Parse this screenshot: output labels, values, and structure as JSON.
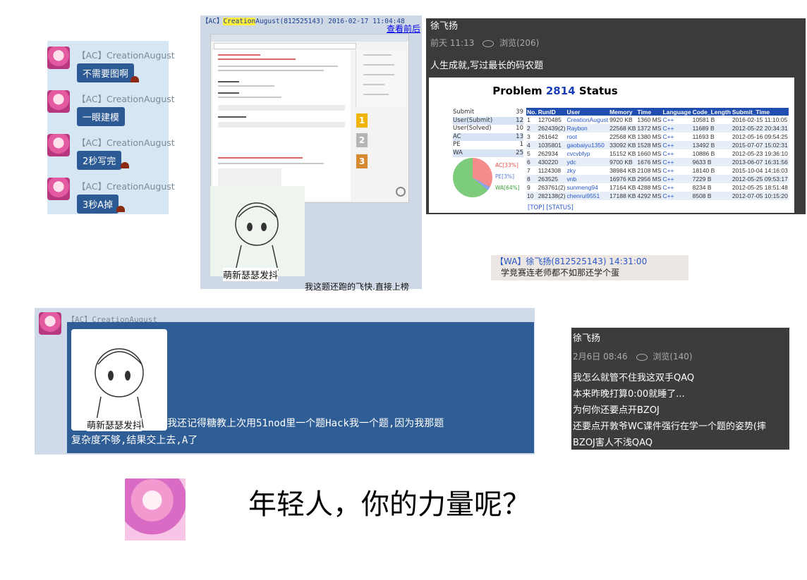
{
  "chatA": {
    "items": [
      {
        "name": "【AC】CreationAugust",
        "text": "不需要图啊"
      },
      {
        "name": "【AC】CreationAugust",
        "text": "一眼建模"
      },
      {
        "name": "【AC】CreationAugust",
        "text": "2秒写完"
      },
      {
        "name": "【AC】CreationAugust",
        "text": "3秒A掉"
      }
    ]
  },
  "shotB": {
    "header_tag": "【AC】",
    "header_name_highlight": "Creation",
    "header_rest": "August(812525143)  2016-02-17 11:04:48",
    "link": "查看前后",
    "rank1": "1",
    "rank2": "2",
    "rank3": "3",
    "sticker_caption": "萌新瑟瑟发抖",
    "caption": "我这题还跑的飞快.直接上榜"
  },
  "panelC": {
    "user": "徐飞扬",
    "time": "前天 11:13",
    "views": "浏览(206)",
    "quote": "人生成就,写过最长的码农题",
    "status_title_pre": "Problem",
    "status_title_num": "2814",
    "status_title_post": "Status",
    "stats": [
      {
        "label": "Submit",
        "value": "39"
      },
      {
        "label": "User(Submit)",
        "value": "12"
      },
      {
        "label": "User(Solved)",
        "value": "10"
      },
      {
        "label": "AC",
        "value": "13"
      },
      {
        "label": "PE",
        "value": "1"
      },
      {
        "label": "WA",
        "value": "25"
      }
    ],
    "pie_legend": [
      "AC[33%]",
      "PE[3%]",
      "WA[64%]"
    ],
    "pie_fractions": [
      0.33,
      0.03,
      0.64
    ],
    "columns": [
      "No.",
      "RunID",
      "User",
      "Memory",
      "Time",
      "Language",
      "Code_Length",
      "Submit_Time"
    ],
    "rows": [
      [
        "1",
        "1270485",
        "CreationAugust",
        "9920 KB",
        "1360 MS",
        "C++",
        "10581 B",
        "2016-02-15 11:10:05"
      ],
      [
        "2",
        "262439(2)",
        "Raybon",
        "22568 KB",
        "1372 MS",
        "C++",
        "11689 B",
        "2012-05-22 20:34:31"
      ],
      [
        "3",
        "261642",
        "root",
        "22568 KB",
        "1380 MS",
        "C++",
        "11693 B",
        "2012-05-16 09:54:25"
      ],
      [
        "4",
        "1035801",
        "gaobaiyu1350",
        "33092 KB",
        "1528 MS",
        "C++",
        "13492 B",
        "2015-07-07 15:02:31"
      ],
      [
        "5",
        "262934",
        "cvcvbfyp",
        "15152 KB",
        "1660 MS",
        "C++",
        "10886 B",
        "2012-05-23 19:36:10"
      ],
      [
        "6",
        "430220",
        "ydc",
        "9700 KB",
        "1676 MS",
        "C++",
        "9633 B",
        "2013-06-07 16:31:56"
      ],
      [
        "7",
        "1124308",
        "zky",
        "38984 KB",
        "2108 MS",
        "C++",
        "18140 B",
        "2015-10-04 14:16:03"
      ],
      [
        "8",
        "263525",
        "vnb",
        "16976 KB",
        "2956 MS",
        "C++",
        "7229 B",
        "2012-05-25 09:53:17"
      ],
      [
        "9",
        "263761(2)",
        "sunmeng94",
        "17164 KB",
        "4288 MS",
        "C++",
        "8234 B",
        "2012-05-25 18:51:48"
      ],
      [
        "10",
        "282138(2)",
        "chenrui9551",
        "17188 KB",
        "4292 MS",
        "C++",
        "8508 B",
        "2012-07-05 10:15:20"
      ]
    ],
    "links": "[TOP]  [STATUS]"
  },
  "panelD": {
    "header": "【WA】徐飞扬(812525143) 14:31:00",
    "body": "学竞赛连老师都不如那还学个蛋"
  },
  "panelE": {
    "name": "【AC】CreationAugust",
    "sticker_caption": "萌新瑟瑟发抖",
    "line1": "我还记得糖教上次用51nod里一个题Hack我一个题,因为我那题",
    "line2": "复杂度不够,结果交上去,A了"
  },
  "panelF": {
    "user": "徐飞扬",
    "time": "2月6日 08:46",
    "views": "浏览(140)",
    "lines": [
      "我怎么就管不住我这双手QAQ",
      "本来昨晚打算0:00就睡了...",
      "为何你还要点开BZOJ",
      "还要点开敦爷WC课件强行在学一个题的姿势(摔",
      "BZOJ害人不浅QAQ"
    ]
  },
  "footer": {
    "text": "年轻人，你的力量呢？"
  },
  "colors": {
    "bubble_blue": "#2c5a95",
    "link_blue": "#2a57c9",
    "dark_panel": "#3b3b3b",
    "header_highlight": "#ffef3d"
  }
}
